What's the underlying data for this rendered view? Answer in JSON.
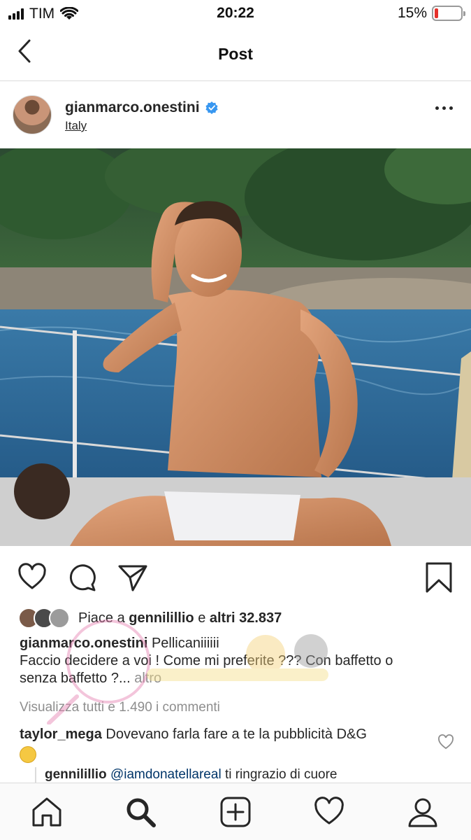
{
  "status_bar": {
    "carrier": "TIM",
    "time": "20:22",
    "battery_percent": "15%",
    "battery_level": 0.15,
    "battery_color": "#e5312b"
  },
  "header": {
    "title": "Post",
    "back_icon": "chevron-left-icon"
  },
  "post": {
    "username": "gianmarco.onestini",
    "verified": true,
    "verified_color": "#3897f0",
    "location": "Italy",
    "likes_prefix": "Piace a",
    "liked_by": "gennilillio",
    "likes_connector": "e",
    "likes_count": "altri 32.837",
    "caption_username": "gianmarco.onestini",
    "caption_line1": "Pellicaniiiiii",
    "caption_line2": "Faccio decidere a voi ! Come mi preferite ??? Con baffetto o",
    "caption_line3": "senza baffetto ?...",
    "caption_more": "altro",
    "view_all_comments": "Visualizza tutti e 1.490 i commenti"
  },
  "comments": [
    {
      "username": "taylor_mega",
      "text": "Dovevano farla fare a te la pubblicità D&G",
      "emoji": "rolling-on-floor-laughing-emoji"
    }
  ],
  "reply": {
    "username": "gennilillio",
    "mention": "@iamdonatellareal",
    "text": "ti ringrazio di cuore"
  },
  "tabs": [
    "home-icon",
    "search-icon",
    "add-post-icon",
    "heart-icon",
    "profile-icon"
  ]
}
